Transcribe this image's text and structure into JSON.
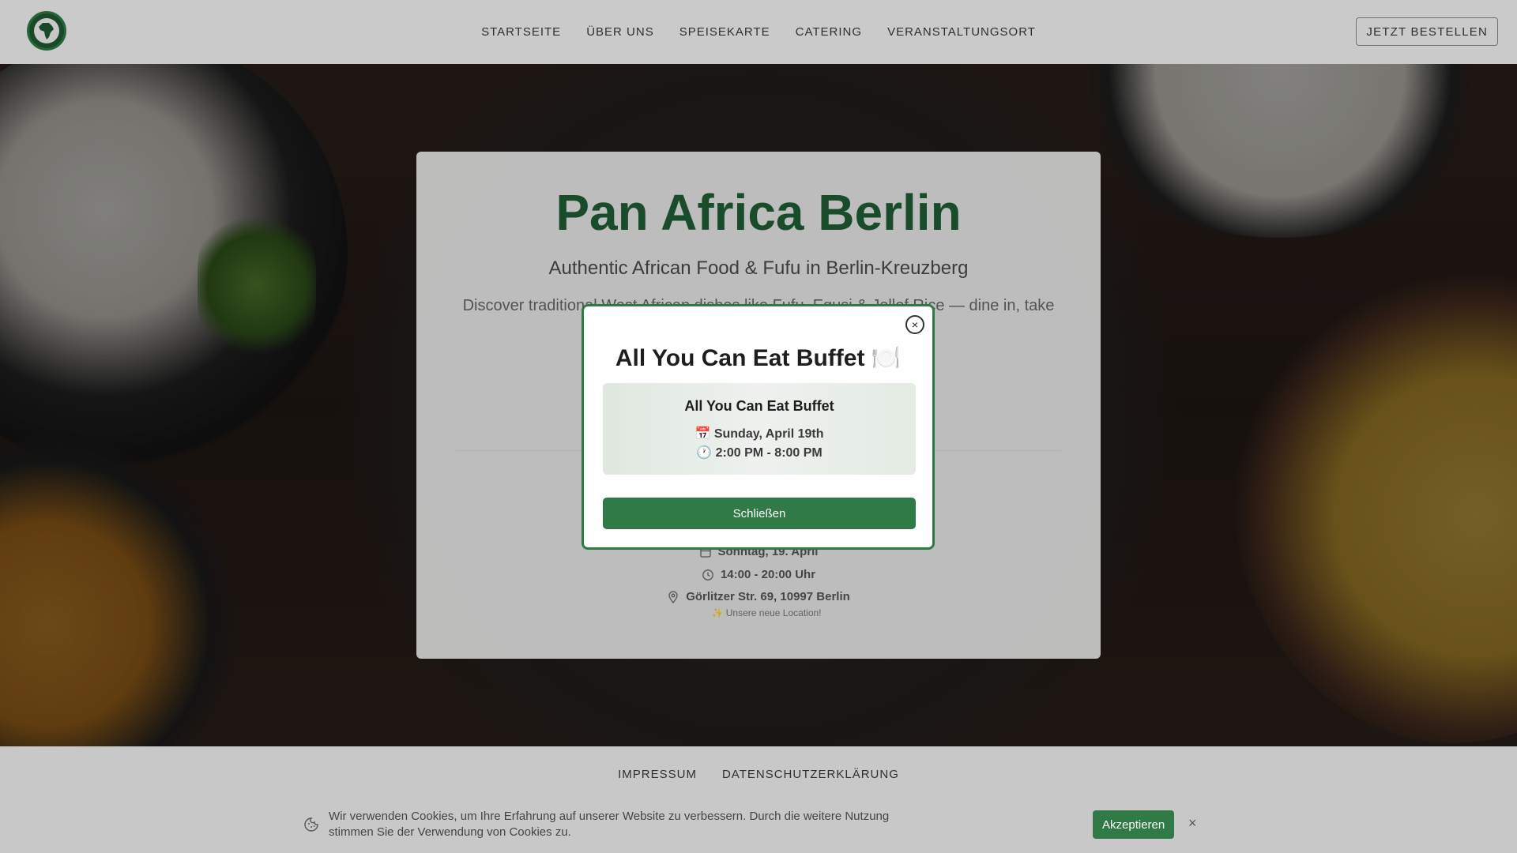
{
  "header": {
    "logo_icon": "africa-map-logo",
    "nav": [
      "STARTSEITE",
      "ÜBER UNS",
      "SPEISEKARTE",
      "CATERING",
      "VERANSTALTUNGSORT"
    ],
    "order_button": "JETZT BESTELLEN"
  },
  "hero": {
    "title": "Pan Africa Berlin",
    "subtitle": "Authentic African Food & Fufu in Berlin-Kreuzberg",
    "description": "Discover traditional West African dishes like Fufu, Egusi & Jollof Rice — dine in, take away or order online in Berlin-Kreuzberg.",
    "event_date": "Sonntag, 19. April",
    "event_time": "14:00 - 20:00 Uhr",
    "address": "Görlitzer Str. 69, 10997 Berlin",
    "location_note": "✨ Unsere neue Location!"
  },
  "modal": {
    "title": "All You Can Eat Buffet 🍽️",
    "box_title": "All You Can Eat Buffet",
    "date_line": "📅 Sunday, April 19th",
    "time_line": "🕐 2:00 PM - 8:00 PM",
    "close_button": "Schließen",
    "close_icon": "×"
  },
  "footer": {
    "links": [
      "IMPRESSUM",
      "DATENSCHUTZERKLÄRUNG"
    ]
  },
  "cookie": {
    "text": "Wir verwenden Cookies, um Ihre Erfahrung auf unserer Website zu verbessern. Durch die weitere Nutzung stimmen Sie der Verwendung von Cookies zu.",
    "accept": "Akzeptieren",
    "close_icon": "×"
  },
  "colors": {
    "brand_green": "#1f5d35",
    "button_green": "#2f7a46"
  }
}
